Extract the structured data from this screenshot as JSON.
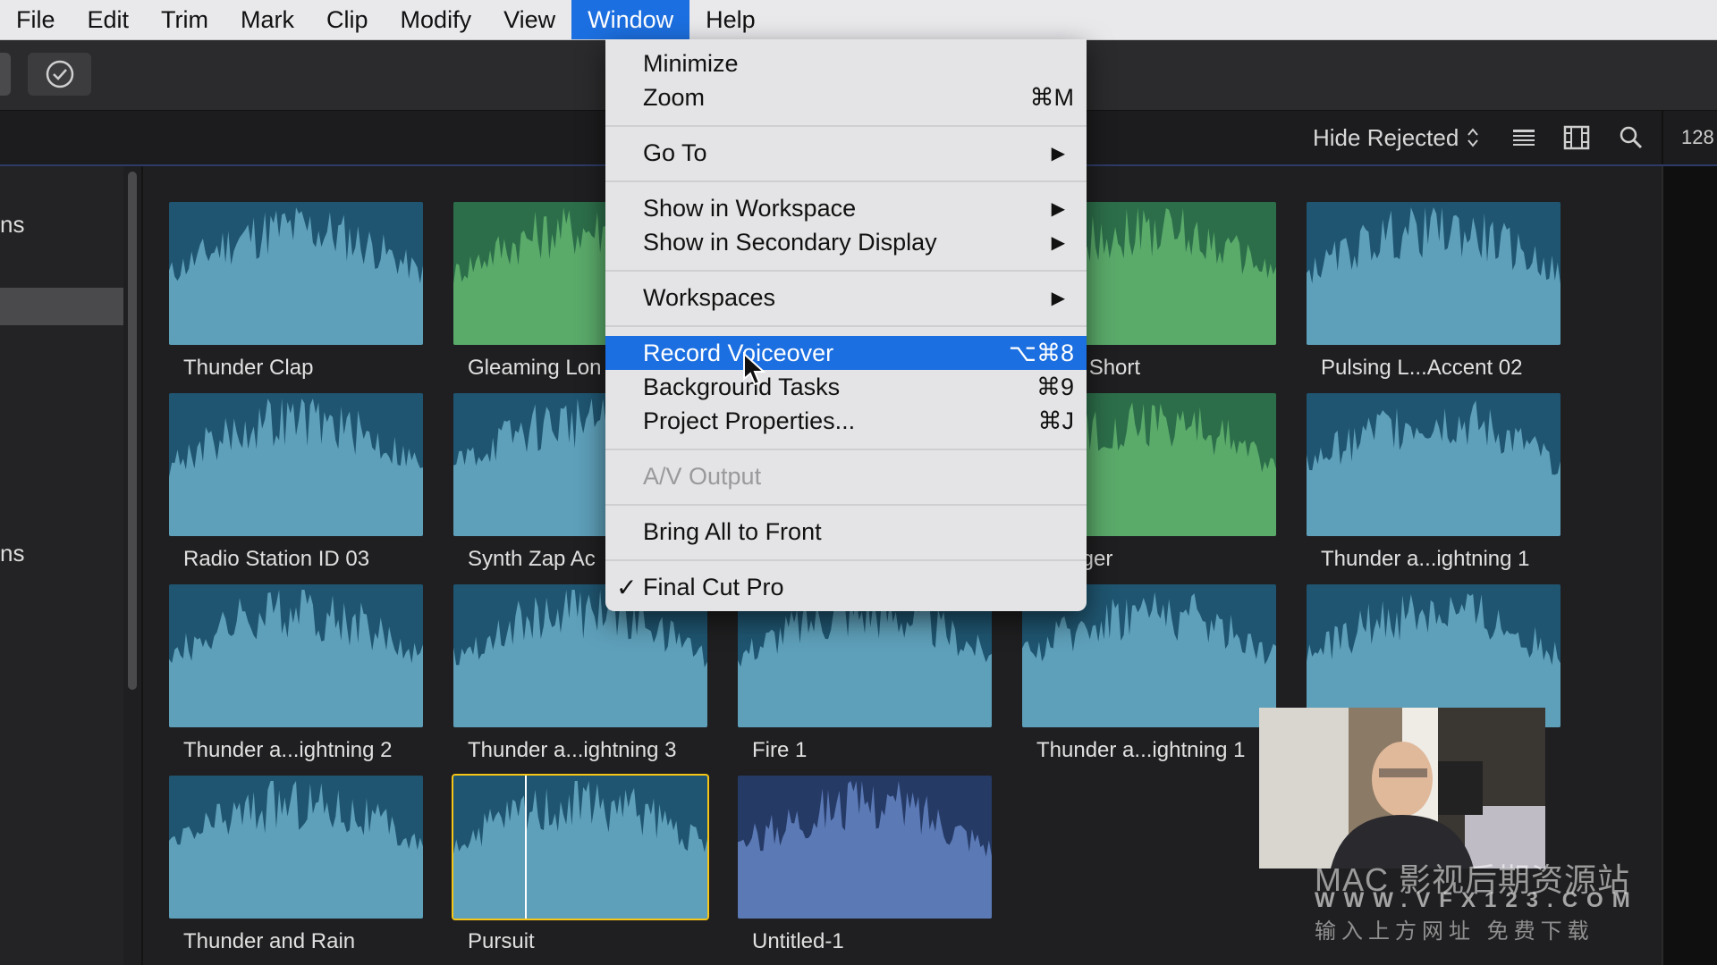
{
  "menubar": {
    "items": [
      {
        "label": "File"
      },
      {
        "label": "Edit"
      },
      {
        "label": "Trim"
      },
      {
        "label": "Mark"
      },
      {
        "label": "Clip"
      },
      {
        "label": "Modify"
      },
      {
        "label": "View"
      },
      {
        "label": "Window",
        "active": true
      },
      {
        "label": "Help"
      }
    ]
  },
  "browser_header": {
    "filter_label": "Hide Rejected",
    "count": "128"
  },
  "sidebar": {
    "item_1": "ns",
    "item_2": "ns"
  },
  "window_menu": {
    "minimize": "Minimize",
    "zoom": "Zoom",
    "zoom_shortcut": "⌘M",
    "go_to": "Go To",
    "show_in_workspace": "Show in Workspace",
    "show_in_secondary": "Show in Secondary Display",
    "workspaces": "Workspaces",
    "record_voiceover": "Record Voiceover",
    "record_voiceover_shortcut": "⌥⌘8",
    "background_tasks": "Background Tasks",
    "background_tasks_shortcut": "⌘9",
    "project_properties": "Project Properties...",
    "project_properties_shortcut": "⌘J",
    "av_output": "A/V Output",
    "bring_all_front": "Bring All to Front",
    "final_cut_pro": "Final Cut Pro",
    "arrow_glyph": "▶",
    "check_glyph": "✓"
  },
  "clips": [
    {
      "label": "Thunder Clap",
      "color": "teal"
    },
    {
      "label": "Gleaming Lon",
      "color": "green"
    },
    {
      "label": "",
      "color": "teal"
    },
    {
      "label": "ming Short",
      "color": "green"
    },
    {
      "label": "Pulsing L...Accent 02",
      "color": "teal"
    },
    {
      "label": "Radio Station ID 03",
      "color": "teal"
    },
    {
      "label": "Synth Zap Ac",
      "color": "teal"
    },
    {
      "label": "",
      "color": "teal"
    },
    {
      "label": "r Stager",
      "color": "green"
    },
    {
      "label": "Thunder a...ightning 1",
      "color": "teal"
    },
    {
      "label": "Thunder a...ightning 2",
      "color": "teal"
    },
    {
      "label": "Thunder a...ightning 3",
      "color": "teal"
    },
    {
      "label": "Fire 1",
      "color": "teal"
    },
    {
      "label": "Thunder a...ightning 1",
      "color": "teal"
    },
    {
      "label": "",
      "color": "teal"
    },
    {
      "label": "Thunder and Rain",
      "color": "teal"
    },
    {
      "label": "Pursuit",
      "color": "teal",
      "selected": true
    },
    {
      "label": "Untitled-1",
      "color": "navy"
    }
  ],
  "colors": {
    "teal_bg": "#1f5570",
    "teal_wave": "#5e9fb9",
    "green_bg": "#2c6e4a",
    "green_wave": "#5aaa6a",
    "navy_bg": "#263a66",
    "navy_wave": "#5a79b5",
    "accent": "#1c6fe0",
    "selected": "#f5c518"
  },
  "watermark": {
    "line1": "MAC 影视后期资源站",
    "line2": "WWW.VFX123.COM",
    "line3": "输入上方网址 免费下载"
  }
}
